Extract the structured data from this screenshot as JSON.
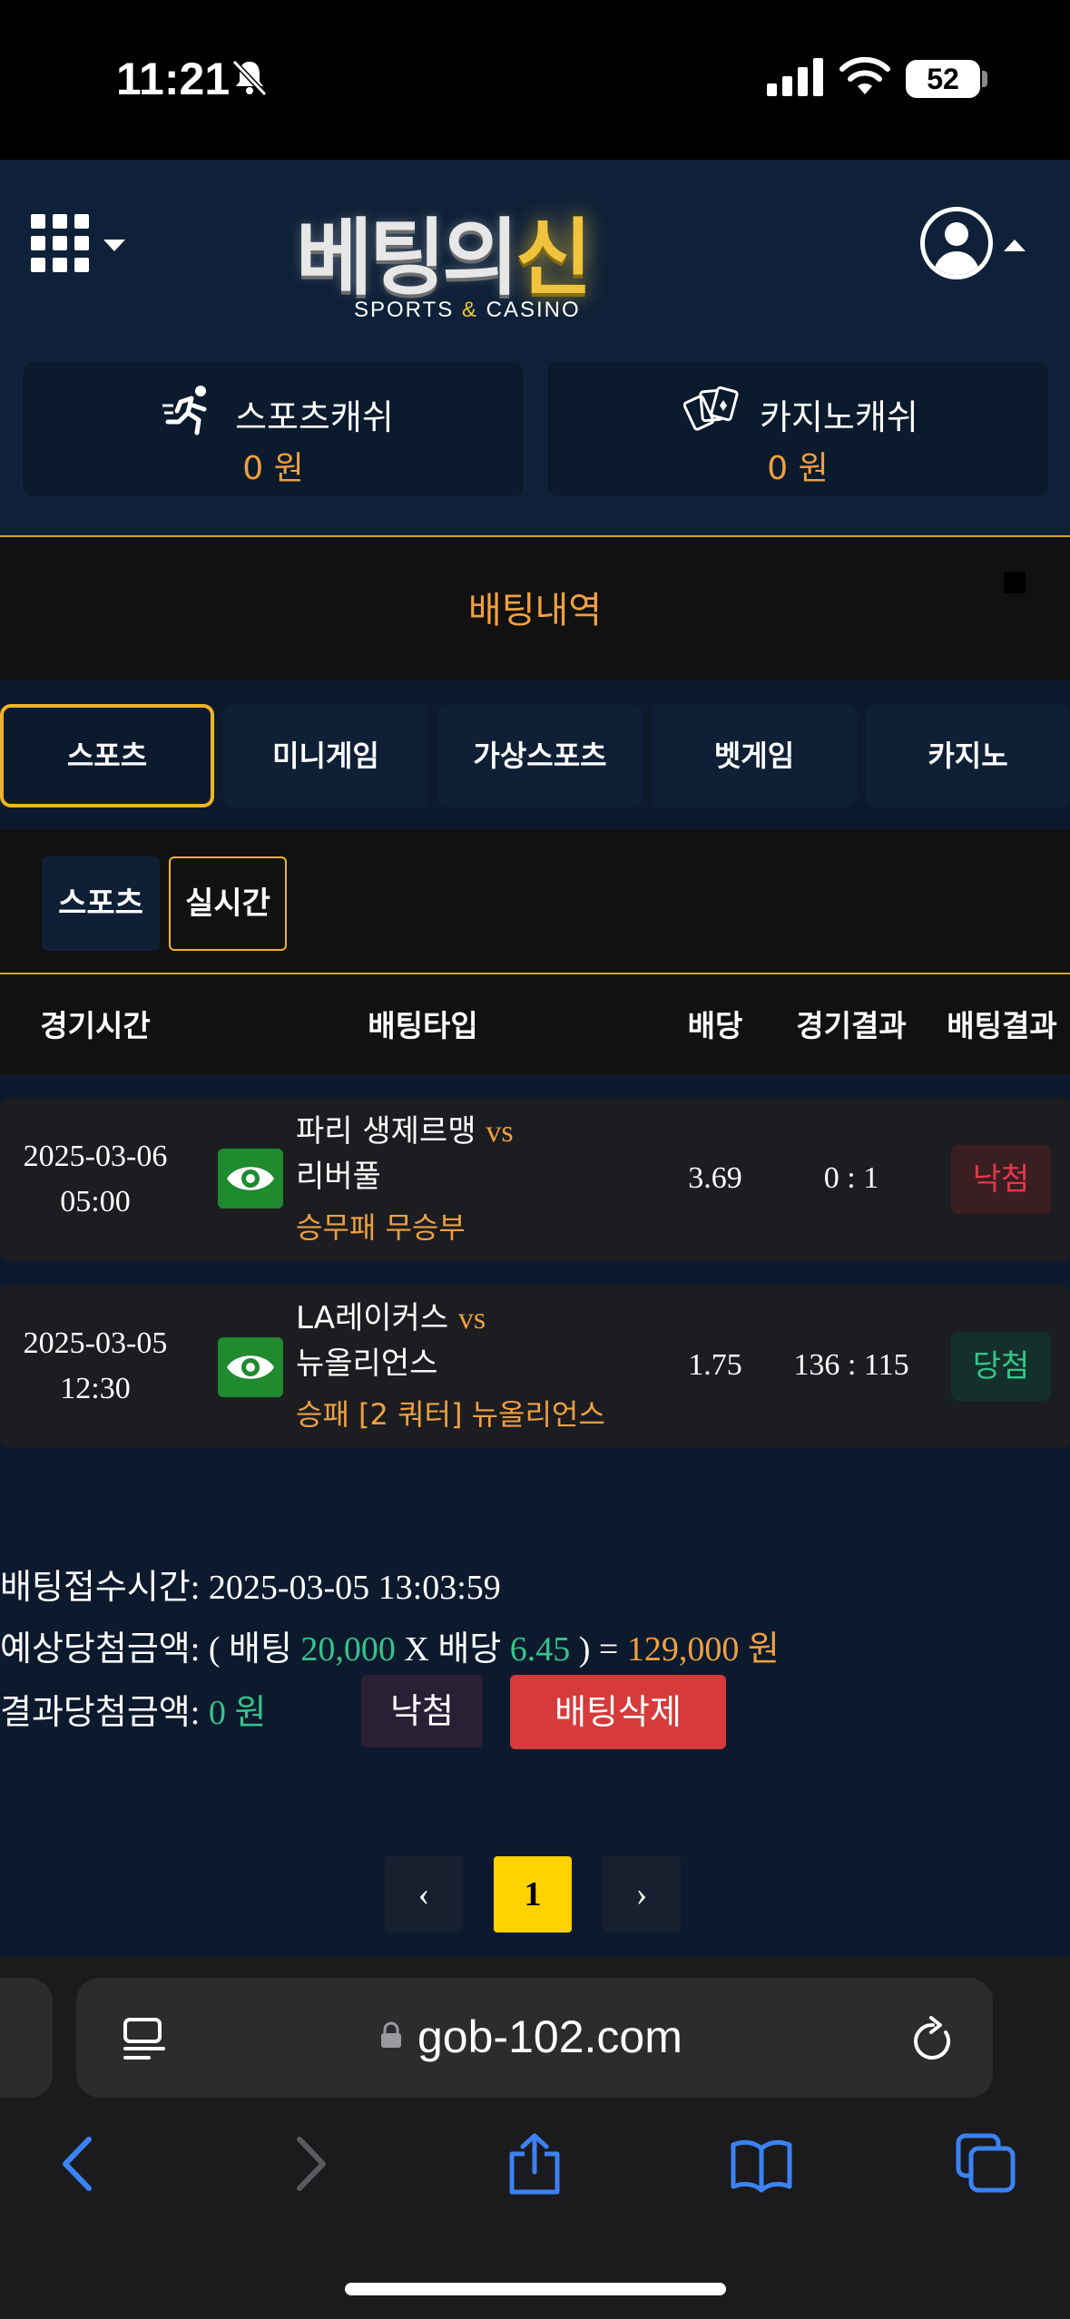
{
  "status_bar": {
    "time": "11:21",
    "battery": "52"
  },
  "header": {
    "logo_main": "베팅의",
    "logo_accent": "신",
    "logo_sub_left": "SPORTS",
    "logo_sub_amp": "&",
    "logo_sub_right": "CASINO"
  },
  "cash": {
    "sports_label": "스포츠캐쉬",
    "sports_value": "0 원",
    "casino_label": "카지노캐쉬",
    "casino_value": "0 원"
  },
  "page_title": "배팅내역",
  "tabs": [
    "스포츠",
    "미니게임",
    "가상스포츠",
    "벳게임",
    "카지노"
  ],
  "subtabs": [
    "스포츠",
    "실시간"
  ],
  "table": {
    "headers": [
      "경기시간",
      "배팅타입",
      "배당",
      "경기결과",
      "배팅결과"
    ],
    "rows": [
      {
        "date": "2025-03-06",
        "time": "05:00",
        "team1": "파리 생제르맹",
        "vs": "vs",
        "team2": "리버풀",
        "bet_type": "승무패 무승부",
        "odds": "3.69",
        "score": "0 : 1",
        "result": "낙첨"
      },
      {
        "date": "2025-03-05",
        "time": "12:30",
        "team1": "LA레이커스",
        "vs": "vs",
        "team2": "뉴올리언스",
        "bet_type": "승패 [2 쿼터] 뉴올리언스",
        "odds": "1.75",
        "score": "136 : 115",
        "result": "당첨"
      }
    ]
  },
  "summary": {
    "received_label": "배팅접수시간:",
    "received_value": "2025-03-05 13:03:59",
    "expected_label": "예상당첨금액:",
    "expected_open": "( 배팅",
    "bet_amount": "20,000",
    "x_label": "X 배당",
    "total_odds": "6.45",
    "expected_close": ") =",
    "expected_amount": "129,000 원",
    "result_label": "결과당첨금액:",
    "result_amount": "0 원",
    "status_button": "낙첨",
    "delete_button": "배팅삭제"
  },
  "pagination": {
    "prev": "‹",
    "current": "1",
    "next": "›"
  },
  "browser": {
    "url": "gob-102.com"
  },
  "colors": {
    "accent_gold": "#f0b429",
    "orange_text": "#f0a040",
    "lose_red": "#e0394a",
    "win_green": "#35c48a",
    "delete_red": "#d63a3a"
  }
}
